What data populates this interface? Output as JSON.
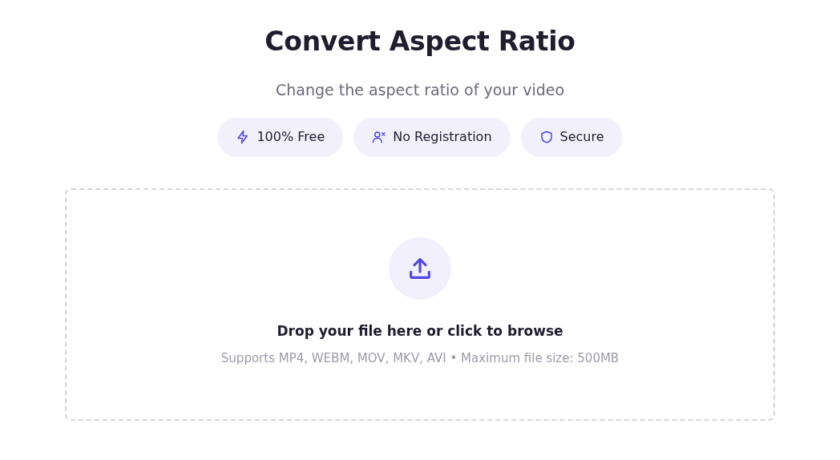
{
  "header": {
    "title": "Convert Aspect Ratio",
    "subtitle": "Change the aspect ratio of your video"
  },
  "badges": [
    {
      "kind": "bolt",
      "label": "100% Free"
    },
    {
      "kind": "user-x",
      "label": "No Registration"
    },
    {
      "kind": "shield",
      "label": "Secure"
    }
  ],
  "dropzone": {
    "prompt": "Drop your file here or click to browse",
    "hint": "Supports MP4, WEBM, MOV, MKV, AVI • Maximum file size: 500MB"
  }
}
